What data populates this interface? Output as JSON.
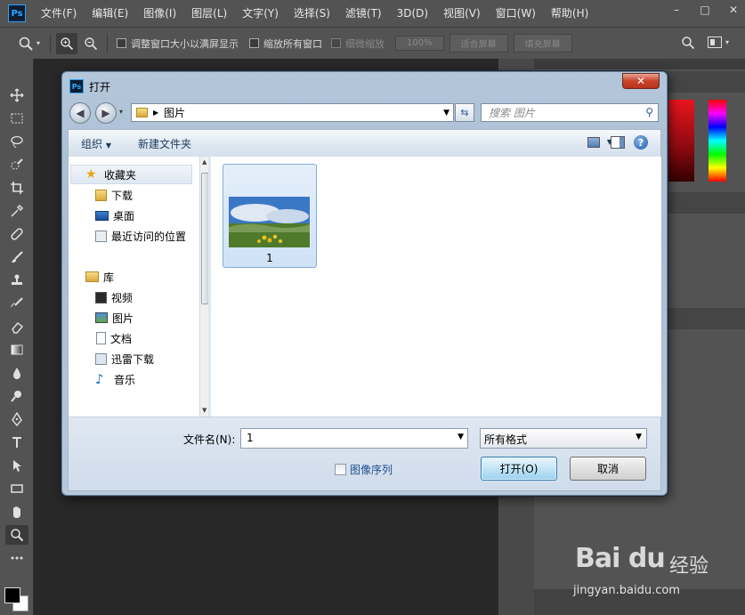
{
  "app": {
    "logo": "Ps",
    "menu": [
      "文件(F)",
      "编辑(E)",
      "图像(I)",
      "图层(L)",
      "文字(Y)",
      "选择(S)",
      "滤镜(T)",
      "3D(D)",
      "视图(V)",
      "窗口(W)",
      "帮助(H)"
    ],
    "window_controls": [
      "–",
      "□",
      "✕"
    ]
  },
  "options_bar": {
    "resize_windows": "调整窗口大小以满屏显示",
    "zoom_all": "缩放所有窗口",
    "scrubby": "细微缩放",
    "zoom_pct": "100%",
    "fit_screen": "适合屏幕",
    "fill_screen": "填充屏幕"
  },
  "dialog": {
    "title": "打开",
    "close": "✕",
    "address_path": "图片",
    "search_placeholder": "搜索 图片",
    "organize": "组织",
    "new_folder": "新建文件夹",
    "help": "?",
    "nav": {
      "favorites": "收藏夹",
      "downloads": "下载",
      "desktop": "桌面",
      "recent": "最近访问的位置",
      "library": "库",
      "videos": "视频",
      "pictures": "图片",
      "documents": "文档",
      "thunder": "迅雷下载",
      "music": "音乐"
    },
    "files": [
      {
        "name": "1"
      }
    ],
    "filename_label": "文件名(N):",
    "filename_value": "1",
    "filter_value": "所有格式",
    "image_sequence": "图像序列",
    "open_button": "打开(O)",
    "cancel_button": "取消"
  },
  "watermark": {
    "logo": "Bai du",
    "cn": "经验",
    "url": "jingyan.baidu.com"
  },
  "colors": {
    "ps_bg": "#535353",
    "workspace": "#282828",
    "dialog_frame": "#b3c6da",
    "accent_blue": "#31a8ff"
  }
}
